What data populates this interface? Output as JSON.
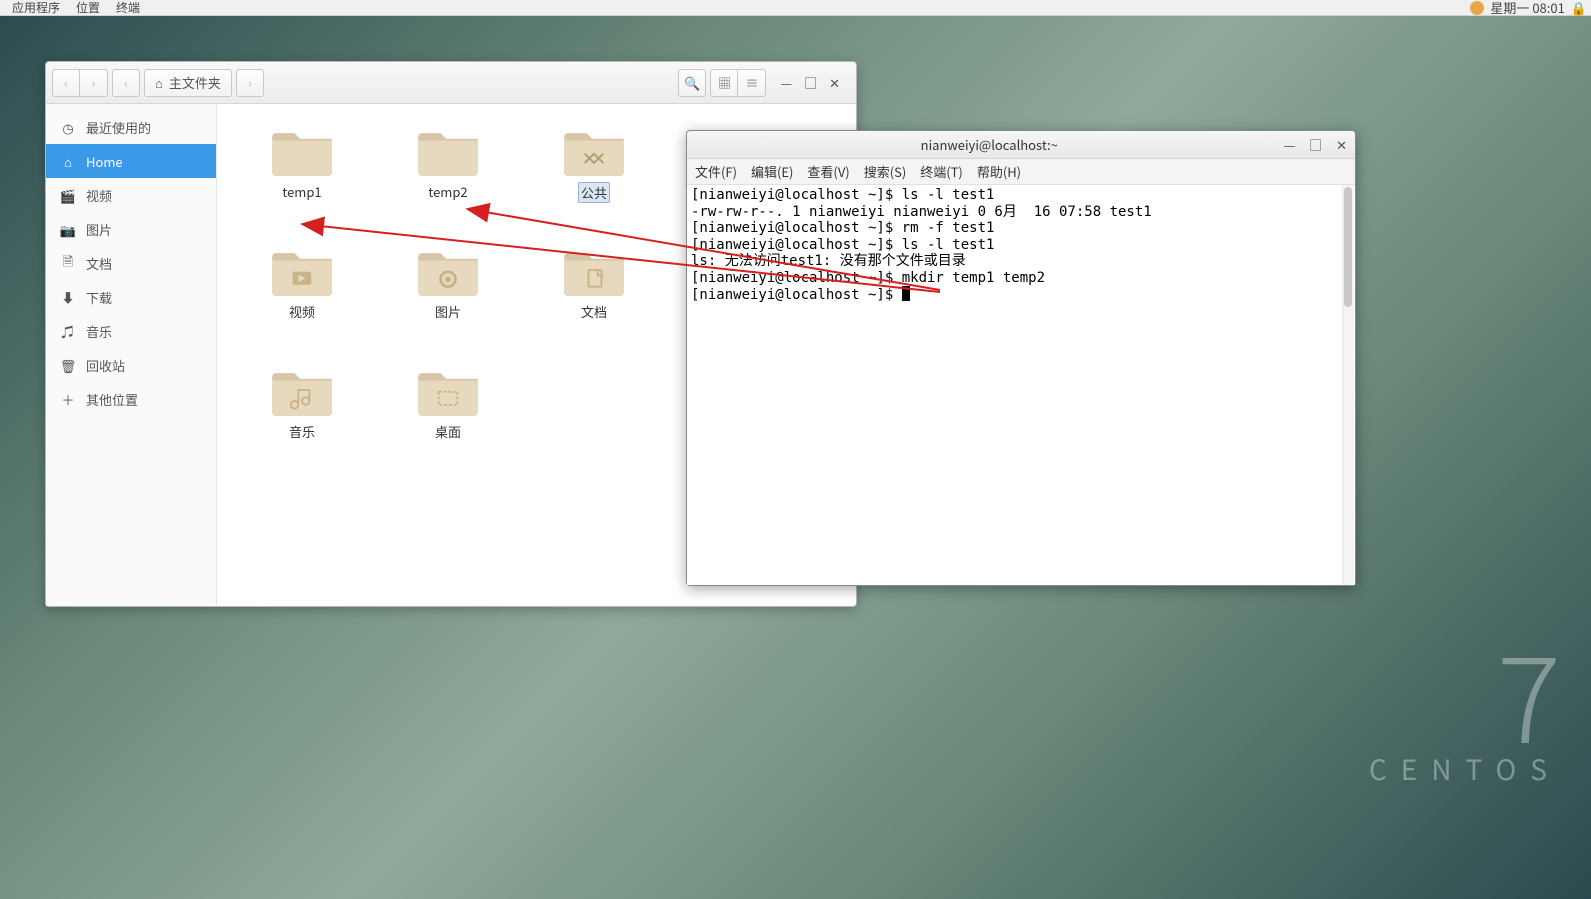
{
  "top_panel": {
    "apps": "应用程序",
    "places": "位置",
    "terminal": "终端",
    "clock": "星期一 08:01"
  },
  "watermark": {
    "big": "7",
    "text": "CENTOS"
  },
  "fm": {
    "path_label": "主文件夹",
    "sidebar": [
      {
        "icon": "clock",
        "label": "最近使用的"
      },
      {
        "icon": "home",
        "label": "Home",
        "active": true
      },
      {
        "icon": "video",
        "label": "视频"
      },
      {
        "icon": "image",
        "label": "图片"
      },
      {
        "icon": "doc",
        "label": "文档"
      },
      {
        "icon": "download",
        "label": "下载"
      },
      {
        "icon": "music",
        "label": "音乐"
      },
      {
        "icon": "trash",
        "label": "回收站"
      },
      {
        "icon": "plus",
        "label": "其他位置"
      }
    ],
    "folders": [
      {
        "name": "temp1",
        "type": "plain"
      },
      {
        "name": "temp2",
        "type": "plain"
      },
      {
        "name": "公共",
        "type": "public",
        "selected": true
      },
      {
        "name": "视频",
        "type": "video"
      },
      {
        "name": "图片",
        "type": "image"
      },
      {
        "name": "文档",
        "type": "doc"
      },
      {
        "name": "音乐",
        "type": "music"
      },
      {
        "name": "桌面",
        "type": "desktop"
      }
    ]
  },
  "term": {
    "title": "nianweiyi@localhost:~",
    "menus": [
      "文件(F)",
      "编辑(E)",
      "查看(V)",
      "搜索(S)",
      "终端(T)",
      "帮助(H)"
    ],
    "lines": [
      "[nianweiyi@localhost ~]$ ls -l test1",
      "-rw-rw-r--. 1 nianweiyi nianweiyi 0 6月  16 07:58 test1",
      "[nianweiyi@localhost ~]$ rm -f test1",
      "[nianweiyi@localhost ~]$ ls -l test1",
      "ls: 无法访问test1: 没有那个文件或目录",
      "[nianweiyi@localhost ~]$ mkdir temp1 temp2",
      "[nianweiyi@localhost ~]$ "
    ]
  }
}
